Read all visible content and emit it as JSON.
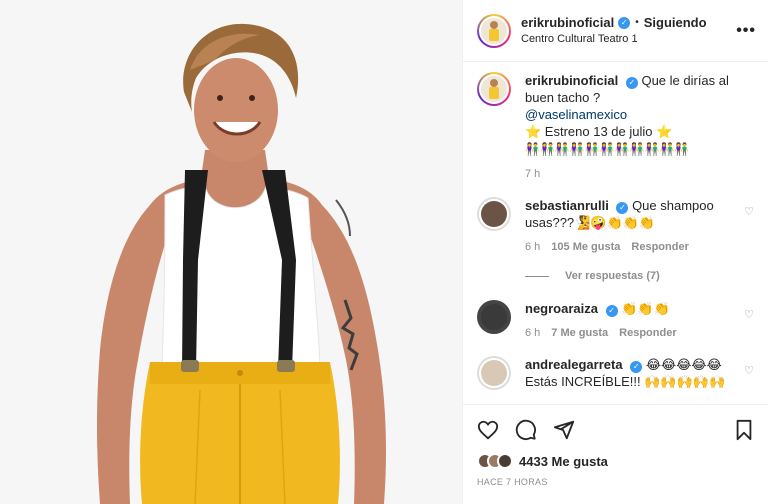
{
  "post": {
    "username": "erikrubinoficial",
    "follow_status": "Siguiendo",
    "separator": "•",
    "location": "Centro Cultural Teatro 1",
    "more_label": "•••",
    "caption_line1": "Que le dirías al buen tacho ?",
    "caption_mention": "@vaselinamexico",
    "caption_line2": "⭐ Estreno 13 de julio ⭐",
    "caption_line3": "👫👫👫👫👫👫👫👫👫👫👫",
    "caption_time": "7 h"
  },
  "comments": [
    {
      "username": "sebastianrulli",
      "text": "Que shampoo usas???🧏🤪👏👏👏",
      "time": "6 h",
      "likes": "105 Me gusta",
      "reply": "Responder",
      "view_replies": "Ver respuestas (7)"
    },
    {
      "username": "negroaraiza",
      "text": "👏👏👏",
      "time": "6 h",
      "likes": "7 Me gusta",
      "reply": "Responder"
    },
    {
      "username": "andrealegarreta",
      "text": "😂😂😂😂😂",
      "text2": "Estás INCREÍBLE!!! 🙌🙌🙌🙌🙌"
    }
  ],
  "actions": {
    "likes_count": "4433 Me gusta",
    "posted_ago": "HACE 7 HORAS"
  },
  "colors": {
    "verified": "#3897f0",
    "mention": "#00376b",
    "muted": "#8e8e8e",
    "pants": "#f2b81f"
  }
}
